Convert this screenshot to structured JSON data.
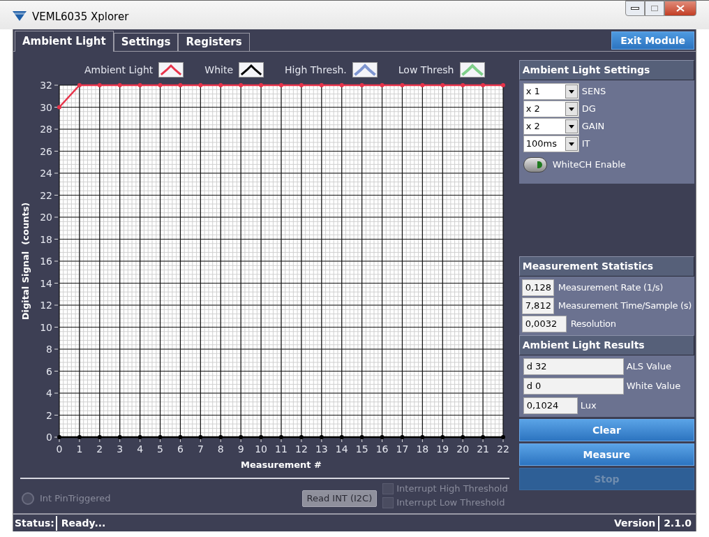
{
  "window": {
    "title": "VEML6035 Xplorer"
  },
  "tabs": [
    {
      "label": "Ambient Light",
      "selected": true
    },
    {
      "label": "Settings",
      "selected": false
    },
    {
      "label": "Registers",
      "selected": false
    }
  ],
  "exit_button": "Exit Module",
  "chart": {
    "legend": [
      {
        "label": "High Thresh.",
        "color": "#7f96d0"
      },
      {
        "label": "Low Thresh",
        "color": "#7fcf8a"
      }
    ],
    "chart_data": {
      "type": "line",
      "grid": true,
      "xlabel": "Measurement #",
      "ylabel": "Digital Signal  (counts)",
      "x": [
        0,
        1,
        2,
        3,
        4,
        5,
        6,
        7,
        8,
        9,
        10,
        11,
        12,
        13,
        14,
        15,
        16,
        17,
        18,
        19,
        20,
        21,
        22
      ],
      "xlim": [
        0,
        22
      ],
      "ylim": [
        0,
        32
      ],
      "xticks": [
        0,
        1,
        2,
        3,
        4,
        5,
        6,
        7,
        8,
        9,
        10,
        11,
        12,
        13,
        14,
        15,
        16,
        17,
        18,
        19,
        20,
        21,
        22
      ],
      "yticks": [
        0,
        2,
        4,
        6,
        8,
        10,
        12,
        14,
        16,
        18,
        20,
        22,
        24,
        26,
        28,
        30,
        32
      ],
      "series": [
        {
          "name": "Ambient Light",
          "color": "#e8334a",
          "marker": "circle",
          "values": [
            30,
            32,
            32,
            32,
            32,
            32,
            32,
            32,
            32,
            32,
            32,
            32,
            32,
            32,
            32,
            32,
            32,
            32,
            32,
            32,
            32,
            32,
            32
          ]
        },
        {
          "name": "White",
          "color": "#000000",
          "marker": "circle",
          "values": [
            0,
            0,
            0,
            0,
            0,
            0,
            0,
            0,
            0,
            0,
            0,
            0,
            0,
            0,
            0,
            0,
            0,
            0,
            0,
            0,
            0,
            0,
            0
          ]
        }
      ]
    }
  },
  "interrupt": {
    "pin_label": "Int PinTriggered",
    "pin_on": false,
    "read_button": "Read INT (I2C)",
    "checks": [
      {
        "label": "Interrupt High Threshold",
        "checked": false
      },
      {
        "label": "Interrupt Low Threshold",
        "checked": false
      }
    ]
  },
  "settings": {
    "title": "Ambient Light Settings",
    "selects": [
      {
        "value": "x 1",
        "label": "SENS"
      },
      {
        "value": "x 2",
        "label": "DG"
      },
      {
        "value": "x 2",
        "label": "GAIN"
      },
      {
        "value": "100ms",
        "label": "IT"
      }
    ],
    "toggle": {
      "label": "WhiteCH Enable",
      "on": true
    }
  },
  "statistics": {
    "title": "Measurement Statistics",
    "fields": [
      {
        "value": "0,128",
        "label": "Measurement Rate (1/s)"
      },
      {
        "value": "7,812",
        "label": "Measurement Time/Sample (s)"
      },
      {
        "value": "0,0032",
        "label": "Resolution"
      }
    ]
  },
  "results": {
    "title": "Ambient Light Results",
    "fields": [
      {
        "value": "d 32",
        "label": "ALS Value",
        "kind": "wide"
      },
      {
        "value": "d 0",
        "label": "White Value",
        "kind": "wide"
      },
      {
        "value": "0,1024",
        "label": "Lux",
        "kind": "narrow"
      }
    ]
  },
  "buttons": [
    {
      "label": "Clear",
      "disabled": false
    },
    {
      "label": "Measure",
      "disabled": false
    },
    {
      "label": "Stop",
      "disabled": true
    }
  ],
  "status_bar": {
    "label": "Status:",
    "value": "Ready...",
    "version_label": "Version",
    "version": "2.1.0"
  }
}
